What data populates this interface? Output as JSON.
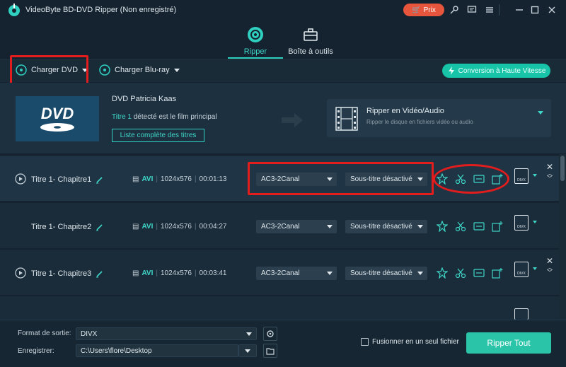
{
  "app": {
    "title": "VideoByte BD-DVD Ripper (Non enregistré)",
    "price_label": "Prix"
  },
  "colors": {
    "accent": "#2fd0c0",
    "price": "#e8553d",
    "highlight_red": "#e11d1d",
    "bg": "#14232f"
  },
  "tabs": [
    {
      "label": "Ripper",
      "icon": "disc-rip-icon",
      "active": true
    },
    {
      "label": "Boîte à outils",
      "icon": "toolbox-icon",
      "active": false
    }
  ],
  "toolbar": {
    "load_dvd": "Charger DVD",
    "load_bluray": "Charger Blu-ray",
    "hq_conversion": "Conversion à Haute Vitesse"
  },
  "source": {
    "name": "DVD Patricia Kaas",
    "detect_highlight": "Titre 1",
    "detect_rest": " détecté est le film principal",
    "list_button": "Liste complète des titres",
    "rip_title": "Ripper en Vidéo/Audio",
    "rip_subtitle": "Ripper le disque en fichiers vidéo ou audio"
  },
  "titles": [
    {
      "name": "Titre 1- Chapitre1",
      "format": "AVI",
      "resolution": "1024x576",
      "duration": "00:01:13",
      "audio": "AC3-2Canal",
      "subtitle": "Sous-titre désactivé",
      "output": "DIVX"
    },
    {
      "name": "Titre 1- Chapitre2",
      "format": "AVI",
      "resolution": "1024x576",
      "duration": "00:04:27",
      "audio": "AC3-2Canal",
      "subtitle": "Sous-titre désactivé",
      "output": "DIVX"
    },
    {
      "name": "Titre 1- Chapitre3",
      "format": "AVI",
      "resolution": "1024x576",
      "duration": "00:03:41",
      "audio": "AC3-2Canal",
      "subtitle": "Sous-titre désactivé",
      "output": "DIVX"
    }
  ],
  "bottom": {
    "format_label": "Format de sortie:",
    "format_value": "DIVX",
    "save_label": "Enregistrer:",
    "save_value": "C:\\Users\\flore\\Desktop",
    "merge_label": "Fusionner en un seul fichier",
    "rip_all": "Ripper Tout"
  }
}
